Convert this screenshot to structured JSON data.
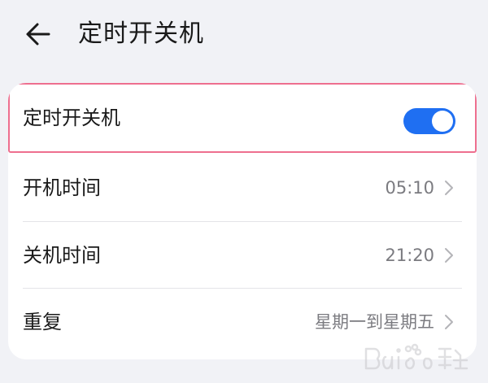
{
  "header": {
    "back_icon": "arrow-left-icon",
    "title": "定时开关机"
  },
  "settings": {
    "schedule_toggle": {
      "label": "定时开关机",
      "enabled": true,
      "accent_color": "#1f6ff2"
    },
    "power_on_time": {
      "label": "开机时间",
      "value": "05:10"
    },
    "power_off_time": {
      "label": "关机时间",
      "value": "21:20"
    },
    "repeat": {
      "label": "重复",
      "value": "星期一到星期五"
    }
  },
  "highlight_color": "#ee6f8f",
  "chevron_icon": "chevron-right-icon",
  "watermark_icon": "baidu-jingyan-watermark-icon"
}
